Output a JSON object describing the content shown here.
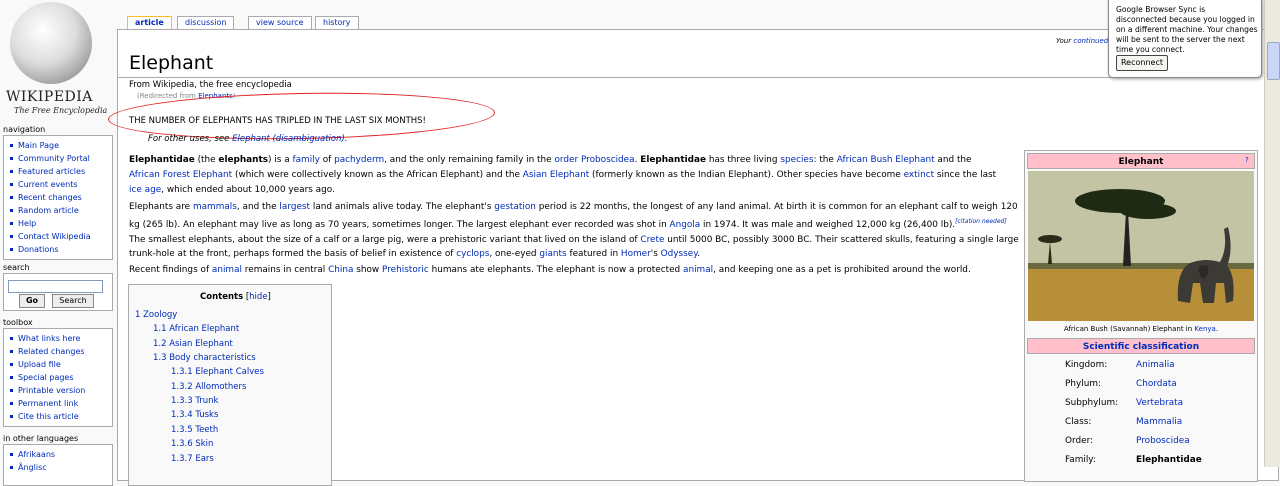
{
  "logo": {
    "title": "WIKIPEDIA",
    "subtitle": "The Free Encyclopedia"
  },
  "tabs": [
    {
      "label": "article",
      "selected": true
    },
    {
      "label": "discussion"
    },
    {
      "label": "view source"
    },
    {
      "label": "history"
    }
  ],
  "sidebar": {
    "navigation_title": "navigation",
    "navigation": [
      "Main Page",
      "Community Portal",
      "Featured articles",
      "Current events",
      "Recent changes",
      "Random article",
      "Help",
      "Contact Wikipedia",
      "Donations"
    ],
    "search_title": "search",
    "search_value": "",
    "go_label": "Go",
    "search_label": "Search",
    "toolbox_title": "toolbox",
    "toolbox": [
      "What links here",
      "Related changes",
      "Upload file",
      "Special pages",
      "Printable version",
      "Permanent link",
      "Cite this article"
    ],
    "languages_title": "in other languages",
    "languages": [
      "Afrikaans",
      "Ãnglisc"
    ]
  },
  "notice": {
    "text": "Your ",
    "link": "continued"
  },
  "article": {
    "title": "Elephant",
    "from": "From Wikipedia, the free encyclopedia",
    "redirect_prefix": "(Redirected from ",
    "redirect_link": "Elephants",
    "redirect_suffix": ")",
    "vandalism": "THE NUMBER OF ELEPHANTS HAS TRIPLED IN THE LAST SIX MONTHS!",
    "other_uses": "For other uses, see ",
    "other_uses_link": "Elephant (disambiguation)",
    "other_uses_end": "."
  },
  "toc": {
    "title": "Contents",
    "hide": "hide",
    "items": [
      "1 Zoology",
      "1.1 African Elephant",
      "1.2 Asian Elephant",
      "1.3 Body characteristics",
      "1.3.1 Elephant Calves",
      "1.3.2 Allomothers",
      "1.3.3 Trunk",
      "1.3.4 Tusks",
      "1.3.5 Teeth",
      "1.3.6 Skin",
      "1.3.7 Ears"
    ]
  },
  "infobox": {
    "title": "Elephant",
    "help": "?",
    "caption": "African Bush (Savannah) Elephant in ",
    "caption_link": "Kenya",
    "caption_end": ".",
    "classification_title": "Scientific classification",
    "rows": [
      {
        "label": "Kingdom:",
        "value": "Animalia"
      },
      {
        "label": "Phylum:",
        "value": "Chordata"
      },
      {
        "label": "Subphylum:",
        "value": "Vertebrata"
      },
      {
        "label": "Class:",
        "value": "Mammalia"
      },
      {
        "label": "Order:",
        "value": "Proboscidea"
      },
      {
        "label": "Family:",
        "value": "Elephantidae"
      }
    ]
  },
  "sync": {
    "message": "Google Browser Sync is disconnected because you logged in on a different machine. Your changes will be sent to the server the next time you connect.",
    "button": "Reconnect"
  },
  "colors": {
    "link": "#002bb8",
    "callout": "#e02020",
    "infobox_header": "#ffc0cb",
    "selected_tab": "#fabd23"
  }
}
